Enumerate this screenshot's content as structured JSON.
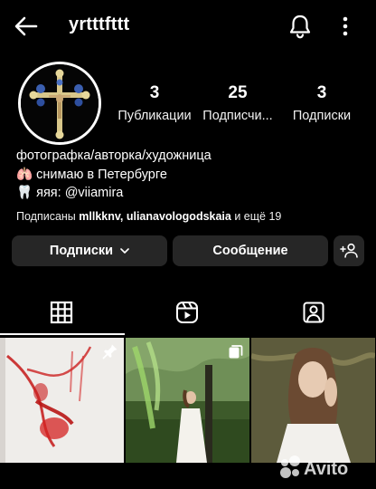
{
  "header": {
    "username": "yrtttfttt"
  },
  "stats": [
    {
      "value": "3",
      "label": "Публикации"
    },
    {
      "value": "25",
      "label": "Подписчи..."
    },
    {
      "value": "3",
      "label": "Подписки"
    }
  ],
  "bio": {
    "line1": "фотографка/авторка/художница",
    "line2_icon": "🫁",
    "line2": "снимаю в Петербурге",
    "line3_icon": "🦷",
    "line3": "яяя: @viiamira"
  },
  "followed_by": {
    "prefix": "Подписаны",
    "names": "mllkknv, ulianavologodskaia",
    "suffix": "и ещё 19"
  },
  "buttons": {
    "following": "Подписки",
    "message": "Сообщение"
  },
  "tabs": [
    "grid-icon",
    "reels-icon",
    "tagged-icon"
  ],
  "posts": [
    {
      "type": "pinned",
      "icon": "pin-icon"
    },
    {
      "type": "carousel",
      "icon": "carousel-icon"
    },
    {
      "type": "single",
      "icon": ""
    }
  ],
  "watermark": {
    "text": "Avito"
  },
  "colors": {
    "background": "#000000",
    "button": "#262626",
    "text": "#ffffff"
  }
}
